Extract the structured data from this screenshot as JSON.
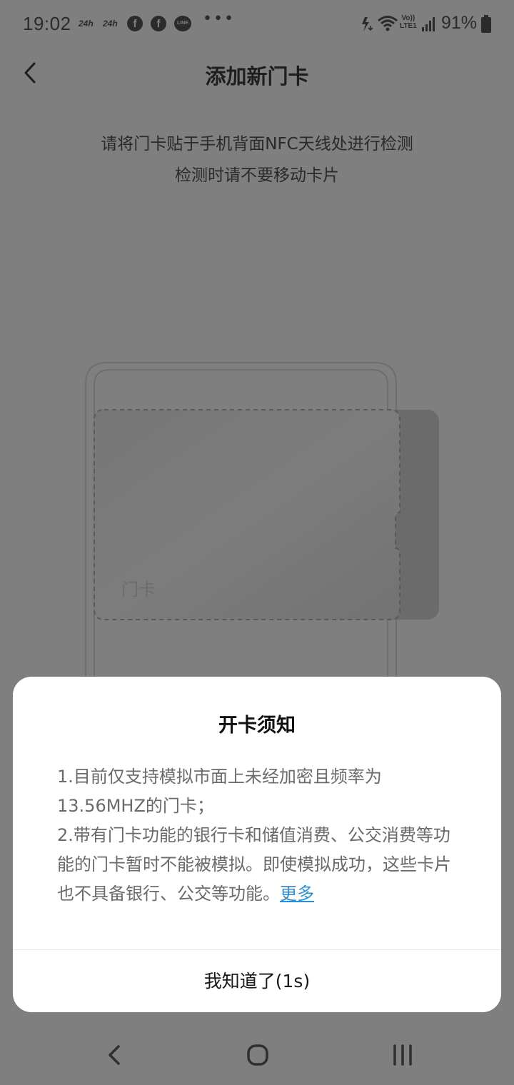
{
  "status_bar": {
    "time": "19:02",
    "notif_24h_1": "24h",
    "notif_24h_2": "24h",
    "fb_icon_1": "f",
    "fb_icon_2": "f",
    "line_icon": "LINE",
    "more_dots": "•••",
    "volte_top": "Vo))",
    "volte_bottom": "LTE1",
    "battery": "91%"
  },
  "header": {
    "title": "添加新门卡"
  },
  "instructions": {
    "line1": "请将门卡贴于手机背面NFC天线处进行检测",
    "line2": "检测时请不要移动卡片"
  },
  "illustration": {
    "card_label": "门卡"
  },
  "dialog": {
    "title": "开卡须知",
    "body": "1.目前仅支持模拟市面上未经加密且频率为13.56MHZ的门卡；\n2.带有门卡功能的银行卡和储值消费、公交消费等功能的门卡暂时不能被模拟。即使模拟成功，这些卡片也不具备银行、公交等功能。",
    "more_link": "更多",
    "confirm_button": "我知道了(1s)"
  },
  "icons": {
    "back": "chevron-left-icon",
    "nav_back": "nav-back-icon",
    "nav_home": "nav-home-icon",
    "nav_recents": "nav-recents-icon"
  },
  "colors": {
    "overlay_background": "#7f7f7f",
    "dialog_background": "#ffffff",
    "link": "#2b8fd6"
  }
}
